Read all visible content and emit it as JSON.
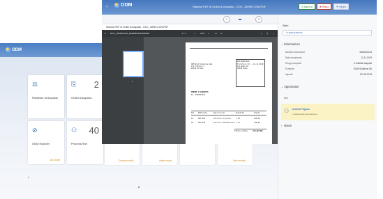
{
  "launchpad": {
    "logo_text": "ODM",
    "tiles": [
      {
        "label": "Richieste di Acquisto",
        "icon": "⚖",
        "count": "",
        "link": ""
      },
      {
        "label": "Ordini d'acquisto",
        "icon": "⎘",
        "count": "2",
        "link": ""
      },
      {
        "label": "ODM Explorer",
        "icon": "⊘",
        "count": "",
        "link": "Vai ai dati"
      },
      {
        "label": "Processi fine",
        "icon": "⚇",
        "count": "40",
        "link": ""
      }
    ],
    "lower_links": [
      "Gestione ordini",
      "Alerts emails",
      "Altre vendite"
    ]
  },
  "viewer_window": {
    "shell_title": "Stampa PDF di Ordini di Acquisto - DOC_1609017226.PDF",
    "logo_text": "ODM",
    "buttons": {
      "approve": "✔ Approva",
      "reject": "✖ Rifiuta",
      "other": "⚑ Integra"
    },
    "steps": [
      "1",
      "2",
      "3"
    ],
    "doc_title": "Stampa PDF di Ordini di Acquisto - DOC_1609017226.PDF",
    "pdf_filename": "DOC_1609017226_6A6B8D72DD1B6D91",
    "page_indicator": "1 / 1",
    "zoom": "75%",
    "thumb_number": "1",
    "page_text": {
      "sender": [
        "ODM Distribuzione SpA",
        "Via Tiziano 1",
        "20145 Milano"
      ],
      "box_title": "DESTINATARIO",
      "box_lines": [
        "Fornitore Srl - 12.11.2019",
        "Via Roma 10",
        "00100 Roma"
      ],
      "order_title": "ORDINE D'ACQUISTO",
      "order_no": "Nr. 4500001234",
      "table_header": [
        "Pos",
        "Materiale",
        "Descrizione",
        "Quantità",
        "Prezzo"
      ],
      "rows": [
        [
          "10",
          "MAT-001",
          "Articolo di prova",
          "5 PZ",
          "120,00"
        ],
        [
          "20",
          "MAT-002",
          "Servizio manutenzione",
          "1 AT",
          "350,00"
        ]
      ],
      "total_label": "Totale ordine",
      "total_value": "470,00 EUR"
    }
  },
  "side_panel": {
    "stato_label": "Stato",
    "stato_value": "In approvazione",
    "info_title": "Informazioni",
    "info_rows": [
      {
        "k": "Numero documento",
        "v": "4500001234"
      },
      {
        "k": "Data documento",
        "v": "12.11.2019"
      },
      {
        "k": "Gruppo Acquisti",
        "v": "C.Intellian Acquisti"
      },
      {
        "k": "Fornitore",
        "v": "ODM Solutions Srl"
      },
      {
        "k": "Importo",
        "v": "470,00 EUR"
      }
    ],
    "approval_title": "Approvatori",
    "approval_step": "M01",
    "approver_name": "Andrea Pagano",
    "approver_role": "In attesa dell'approvazione",
    "notes_title": "Notes"
  },
  "colors": {
    "shell": "#4577bf",
    "approve": "#2f8a3a",
    "reject": "#c0392b",
    "approver_highlight": "#fbf3c6"
  }
}
